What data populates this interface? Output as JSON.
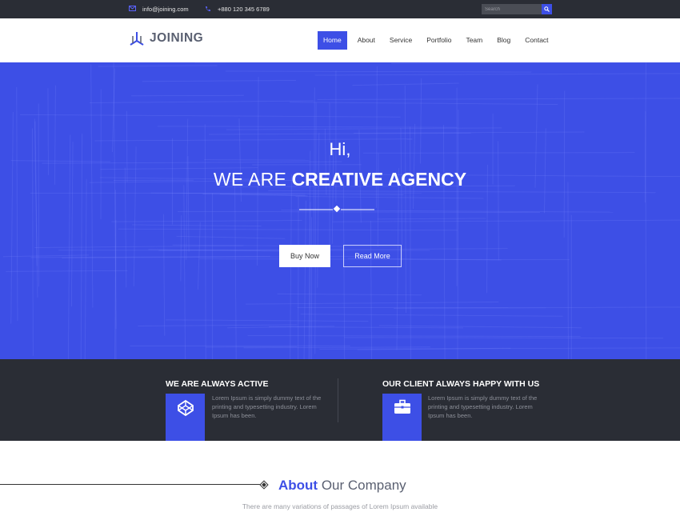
{
  "topbar": {
    "email": "info@joining.com",
    "phone": "+880 120 345 6789",
    "search_placeholder": "Search",
    "email_icon": "envelope-icon",
    "phone_icon": "phone-icon",
    "search_icon": "search-icon"
  },
  "header": {
    "logo_text": "JOINING",
    "nav": [
      {
        "label": "Home",
        "active": true
      },
      {
        "label": "Service"
      },
      {
        "label": "Portfolio"
      },
      {
        "label": "Team"
      },
      {
        "label": "Blog"
      },
      {
        "label": "Contact"
      }
    ],
    "nav_about": "About"
  },
  "hero": {
    "greeting": "Hi,",
    "title_light": "WE ARE",
    "title_bold": "CREATIVE AGENCY",
    "buy_label": "Buy Now",
    "read_label": "Read More"
  },
  "features": [
    {
      "title": "WE ARE ALWAYS ACTIVE",
      "icon": "codepen-icon",
      "text": "Lorem Ipsum is simply dummy text of the printing and typesetting industry. Lorem Ipsum has been."
    },
    {
      "title": "OUR CLIENT ALWAYS HAPPY WITH US",
      "icon": "briefcase-icon",
      "text": "Lorem Ipsum is simply dummy text of the printing and typesetting industry. Lorem Ipsum has been."
    }
  ],
  "about": {
    "title_accent": "About",
    "title_rest": "Our Company",
    "subtitle": "There are many variations of passages of Lorem Ipsum available"
  },
  "colors": {
    "primary": "#3d4fe6",
    "dark": "#2a2d35",
    "muted_text": "#9a9ca3"
  }
}
